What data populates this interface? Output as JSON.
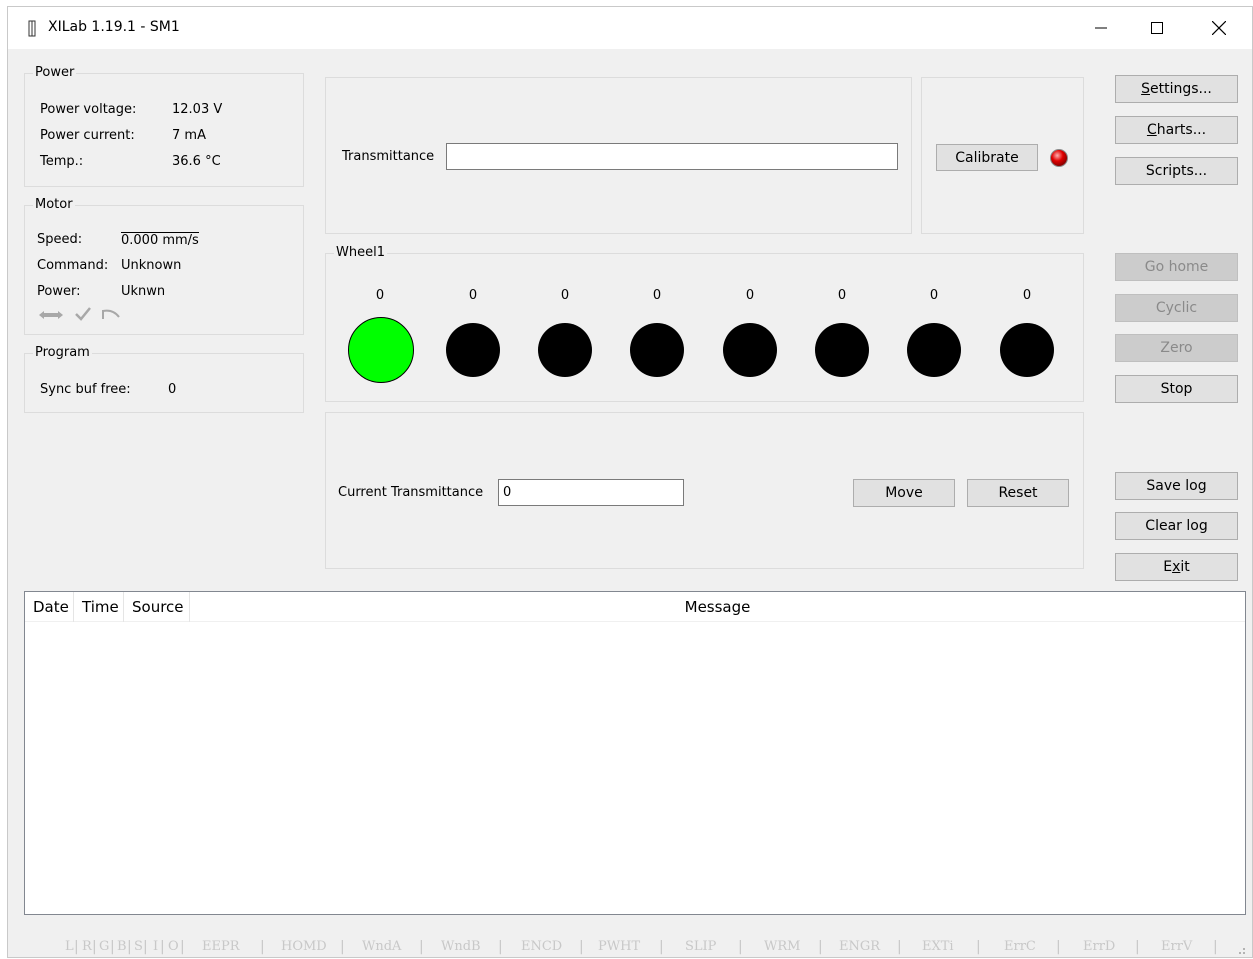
{
  "window": {
    "title": "XILab 1.19.1 - SM1"
  },
  "power": {
    "group_title": "Power",
    "voltage_label": "Power voltage:",
    "voltage_value": "12.03 V",
    "current_label": "Power current:",
    "current_value": "7 mA",
    "temp_label": "Temp.:",
    "temp_value": "36.6 °C"
  },
  "motor": {
    "group_title": "Motor",
    "speed_label": "Speed:",
    "speed_value": "0.000 mm/s",
    "command_label": "Command:",
    "command_value": "Unknown",
    "power_label": "Power:",
    "power_value": "Uknwn",
    "status_icons": [
      "arrows-horizontal-icon",
      "check-icon",
      "undo-icon"
    ]
  },
  "program": {
    "group_title": "Program",
    "sync_label": "Sync buf free:",
    "sync_value": "0"
  },
  "transmittance": {
    "label": "Transmittance",
    "value": "",
    "calibrate_label": "Calibrate",
    "indicator_color": "#e00000"
  },
  "wheel": {
    "group_title": "Wheel1",
    "values": [
      "0",
      "0",
      "0",
      "0",
      "0",
      "0",
      "0",
      "0"
    ],
    "active_index": 0,
    "active_color": "#00ff00",
    "inactive_color": "#000000"
  },
  "current": {
    "label": "Current Transmittance",
    "value": "0",
    "move_label": "Move",
    "reset_label": "Reset"
  },
  "side_buttons": {
    "settings_pre": "",
    "settings_u": "S",
    "settings_post": "ettings...",
    "charts_pre": "",
    "charts_u": "C",
    "charts_post": "harts...",
    "scripts": "Scripts...",
    "go_home": "Go home",
    "cyclic": "Cyclic",
    "zero": "Zero",
    "stop": "Stop",
    "save_log": "Save log",
    "clear_log": "Clear log",
    "exit_pre": "E",
    "exit_u": "x",
    "exit_post": "it"
  },
  "log": {
    "columns": [
      "Date",
      "Time",
      "Source",
      "Message"
    ]
  },
  "status_flags": [
    "L",
    "R",
    "G",
    "B",
    "S",
    "I",
    "O",
    "EEPR",
    "HOMD",
    "WndA",
    "WndB",
    "ENCD",
    "PWHT",
    "SLIP",
    "WRM",
    "ENGR",
    "EXTi",
    "ErrC",
    "ErrD",
    "ErrV"
  ]
}
